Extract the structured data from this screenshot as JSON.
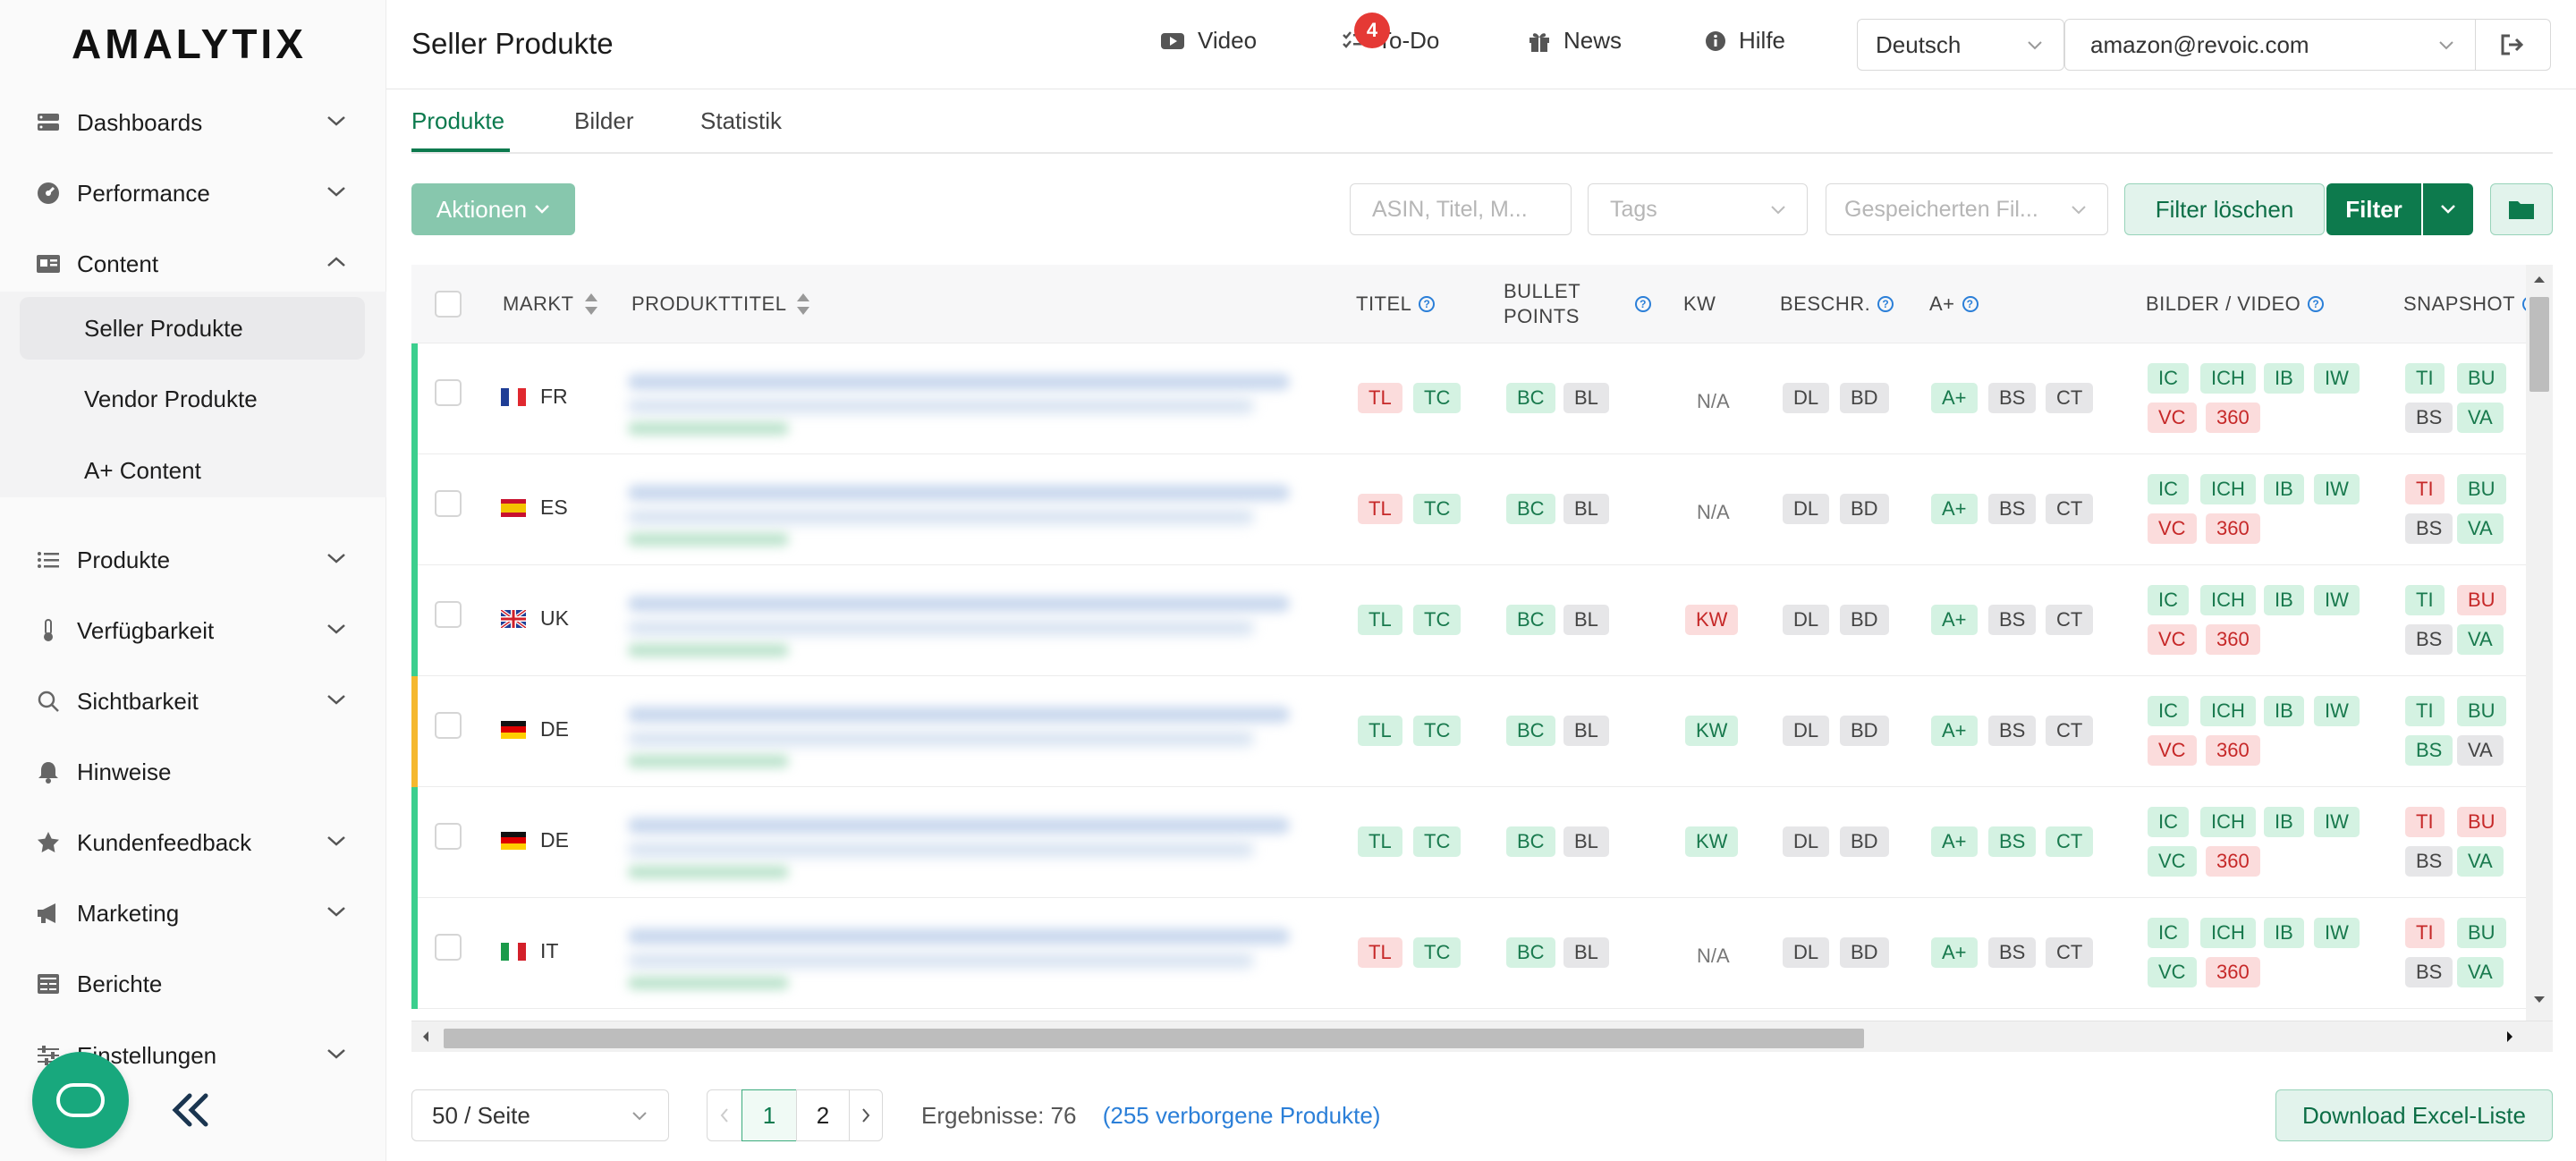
{
  "app": {
    "logo": "AMALYTIX"
  },
  "sidebar": {
    "items": [
      {
        "label": "Dashboards",
        "icon": "dashboard-icon"
      },
      {
        "label": "Performance",
        "icon": "gauge-icon"
      },
      {
        "label": "Content",
        "icon": "content-icon"
      },
      {
        "label": "Produkte",
        "icon": "list-icon"
      },
      {
        "label": "Verfügbarkeit",
        "icon": "thermometer-icon"
      },
      {
        "label": "Sichtbarkeit",
        "icon": "search-icon"
      },
      {
        "label": "Hinweise",
        "icon": "bell-icon"
      },
      {
        "label": "Kundenfeedback",
        "icon": "star-icon"
      },
      {
        "label": "Marketing",
        "icon": "megaphone-icon"
      },
      {
        "label": "Berichte",
        "icon": "report-icon"
      },
      {
        "label": "Einstellungen",
        "icon": "sliders-icon"
      }
    ],
    "content_sub": [
      "Seller Produkte",
      "Vendor Produkte",
      "A+ Content"
    ]
  },
  "header": {
    "title": "Seller Produkte",
    "video": "Video",
    "todo": "To-Do",
    "todo_badge": "4",
    "news": "News",
    "help": "Hilfe",
    "language": "Deutsch",
    "account": "amazon@revoic.com"
  },
  "tabs": [
    "Produkte",
    "Bilder",
    "Statistik"
  ],
  "toolbar": {
    "actions": "Aktionen",
    "search_placeholder": "ASIN, Titel, M...",
    "tags_placeholder": "Tags",
    "saved_placeholder": "Gespeicherten Fil...",
    "clear": "Filter löschen",
    "filter": "Filter"
  },
  "table": {
    "headers": {
      "markt": "MARKT",
      "produkttitel": "PRODUKTTITEL",
      "titel": "TITEL",
      "bullet1": "BULLET",
      "bullet2": "POINTS",
      "kw": "KW",
      "beschr": "BESCHR.",
      "aplus": "A+",
      "bilder": "BILDER / VIDEO",
      "snapshot": "SNAPSHOT"
    },
    "rows": [
      {
        "market": "FR",
        "flag": "fr",
        "status_color": "#3ccf8e",
        "titel": [
          [
            "TL",
            "r"
          ],
          [
            "TC",
            "g"
          ]
        ],
        "bullets": [
          [
            "BC",
            "g"
          ],
          [
            "BL",
            "n"
          ]
        ],
        "kw": [
          "N/A",
          "na"
        ],
        "beschr": [
          [
            "DL",
            "n"
          ],
          [
            "BD",
            "n"
          ]
        ],
        "aplus": [
          [
            "A+",
            "g"
          ],
          [
            "BS",
            "n"
          ],
          [
            "CT",
            "n"
          ]
        ],
        "bilder": [
          [
            "IC",
            "g"
          ],
          [
            "ICH",
            "g"
          ],
          [
            "IB",
            "g"
          ],
          [
            "IW",
            "g"
          ],
          [
            "VC",
            "r"
          ],
          [
            "360",
            "r"
          ]
        ],
        "snapshot": [
          [
            "TI",
            "g"
          ],
          [
            "BU",
            "g"
          ],
          [
            "BS",
            "n"
          ],
          [
            "VA",
            "g"
          ]
        ]
      },
      {
        "market": "ES",
        "flag": "es",
        "status_color": "#3ccf8e",
        "titel": [
          [
            "TL",
            "r"
          ],
          [
            "TC",
            "g"
          ]
        ],
        "bullets": [
          [
            "BC",
            "g"
          ],
          [
            "BL",
            "n"
          ]
        ],
        "kw": [
          "N/A",
          "na"
        ],
        "beschr": [
          [
            "DL",
            "n"
          ],
          [
            "BD",
            "n"
          ]
        ],
        "aplus": [
          [
            "A+",
            "g"
          ],
          [
            "BS",
            "n"
          ],
          [
            "CT",
            "n"
          ]
        ],
        "bilder": [
          [
            "IC",
            "g"
          ],
          [
            "ICH",
            "g"
          ],
          [
            "IB",
            "g"
          ],
          [
            "IW",
            "g"
          ],
          [
            "VC",
            "r"
          ],
          [
            "360",
            "r"
          ]
        ],
        "snapshot": [
          [
            "TI",
            "r"
          ],
          [
            "BU",
            "g"
          ],
          [
            "BS",
            "n"
          ],
          [
            "VA",
            "g"
          ]
        ]
      },
      {
        "market": "UK",
        "flag": "uk",
        "status_color": "#3ccf8e",
        "titel": [
          [
            "TL",
            "g"
          ],
          [
            "TC",
            "g"
          ]
        ],
        "bullets": [
          [
            "BC",
            "g"
          ],
          [
            "BL",
            "n"
          ]
        ],
        "kw": [
          "KW",
          "r"
        ],
        "beschr": [
          [
            "DL",
            "n"
          ],
          [
            "BD",
            "n"
          ]
        ],
        "aplus": [
          [
            "A+",
            "g"
          ],
          [
            "BS",
            "n"
          ],
          [
            "CT",
            "n"
          ]
        ],
        "bilder": [
          [
            "IC",
            "g"
          ],
          [
            "ICH",
            "g"
          ],
          [
            "IB",
            "g"
          ],
          [
            "IW",
            "g"
          ],
          [
            "VC",
            "r"
          ],
          [
            "360",
            "r"
          ]
        ],
        "snapshot": [
          [
            "TI",
            "g"
          ],
          [
            "BU",
            "r"
          ],
          [
            "BS",
            "n"
          ],
          [
            "VA",
            "g"
          ]
        ]
      },
      {
        "market": "DE",
        "flag": "de",
        "status_color": "#f5b82e",
        "titel": [
          [
            "TL",
            "g"
          ],
          [
            "TC",
            "g"
          ]
        ],
        "bullets": [
          [
            "BC",
            "g"
          ],
          [
            "BL",
            "n"
          ]
        ],
        "kw": [
          "KW",
          "g"
        ],
        "beschr": [
          [
            "DL",
            "n"
          ],
          [
            "BD",
            "n"
          ]
        ],
        "aplus": [
          [
            "A+",
            "g"
          ],
          [
            "BS",
            "n"
          ],
          [
            "CT",
            "n"
          ]
        ],
        "bilder": [
          [
            "IC",
            "g"
          ],
          [
            "ICH",
            "g"
          ],
          [
            "IB",
            "g"
          ],
          [
            "IW",
            "g"
          ],
          [
            "VC",
            "r"
          ],
          [
            "360",
            "r"
          ]
        ],
        "snapshot": [
          [
            "TI",
            "g"
          ],
          [
            "BU",
            "g"
          ],
          [
            "BS",
            "g"
          ],
          [
            "VA",
            "n"
          ]
        ]
      },
      {
        "market": "DE",
        "flag": "de",
        "status_color": "#3ccf8e",
        "titel": [
          [
            "TL",
            "g"
          ],
          [
            "TC",
            "g"
          ]
        ],
        "bullets": [
          [
            "BC",
            "g"
          ],
          [
            "BL",
            "n"
          ]
        ],
        "kw": [
          "KW",
          "g"
        ],
        "beschr": [
          [
            "DL",
            "n"
          ],
          [
            "BD",
            "n"
          ]
        ],
        "aplus": [
          [
            "A+",
            "g"
          ],
          [
            "BS",
            "g"
          ],
          [
            "CT",
            "g"
          ]
        ],
        "bilder": [
          [
            "IC",
            "g"
          ],
          [
            "ICH",
            "g"
          ],
          [
            "IB",
            "g"
          ],
          [
            "IW",
            "g"
          ],
          [
            "VC",
            "g"
          ],
          [
            "360",
            "r"
          ]
        ],
        "snapshot": [
          [
            "TI",
            "r"
          ],
          [
            "BU",
            "r"
          ],
          [
            "BS",
            "n"
          ],
          [
            "VA",
            "g"
          ]
        ]
      },
      {
        "market": "IT",
        "flag": "it",
        "status_color": "#3ccf8e",
        "titel": [
          [
            "TL",
            "r"
          ],
          [
            "TC",
            "g"
          ]
        ],
        "bullets": [
          [
            "BC",
            "g"
          ],
          [
            "BL",
            "n"
          ]
        ],
        "kw": [
          "N/A",
          "na"
        ],
        "beschr": [
          [
            "DL",
            "n"
          ],
          [
            "BD",
            "n"
          ]
        ],
        "aplus": [
          [
            "A+",
            "g"
          ],
          [
            "BS",
            "n"
          ],
          [
            "CT",
            "n"
          ]
        ],
        "bilder": [
          [
            "IC",
            "g"
          ],
          [
            "ICH",
            "g"
          ],
          [
            "IB",
            "g"
          ],
          [
            "IW",
            "g"
          ],
          [
            "VC",
            "g"
          ],
          [
            "360",
            "r"
          ]
        ],
        "snapshot": [
          [
            "TI",
            "r"
          ],
          [
            "BU",
            "g"
          ],
          [
            "BS",
            "n"
          ],
          [
            "VA",
            "g"
          ]
        ]
      }
    ]
  },
  "footer": {
    "page_size": "50 / Seite",
    "pages": [
      "1",
      "2"
    ],
    "results_label": "Ergebnisse: 76",
    "hidden_open": "(",
    "hidden_link": "255 verborgene Produkte",
    "hidden_close": ")",
    "download": "Download Excel-Liste"
  },
  "colors": {
    "accent": "#0d7a4d",
    "accent_light": "#e2f3ec",
    "ok": "#3ccf8e",
    "warn": "#f5b82e"
  }
}
